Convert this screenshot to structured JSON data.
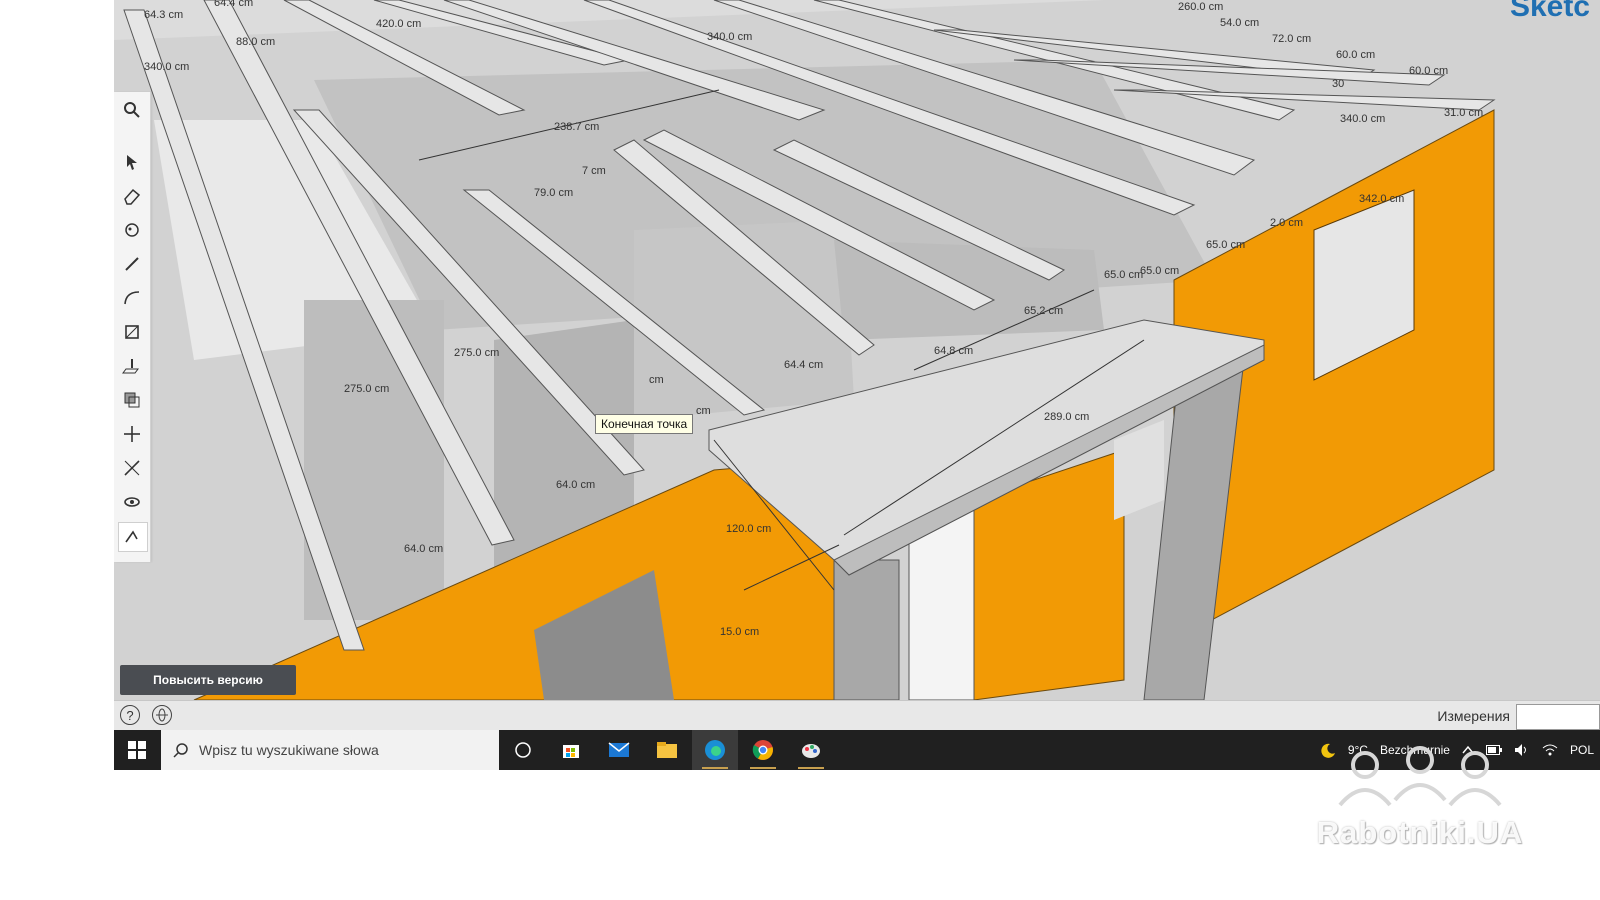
{
  "app": {
    "brand_fragment": "Sketc"
  },
  "colors": {
    "wall": "#f29a05",
    "beam": "#e6e6e6",
    "floor": "#c8c8c8",
    "taskbar": "#202020"
  },
  "toolbar": {
    "tools": [
      "search-icon",
      "select-icon",
      "eraser-icon",
      "paint-bucket-icon",
      "pencil-icon",
      "arc-icon",
      "rectangle-icon",
      "push-pull-icon",
      "offset-icon",
      "move-icon",
      "tape-measure-icon",
      "orbit-icon",
      "dimension-icon"
    ]
  },
  "dimensions": [
    {
      "id": "d1",
      "text": "64.3 cm"
    },
    {
      "id": "d2",
      "text": "64.4 cm"
    },
    {
      "id": "d3",
      "text": "88.0 cm"
    },
    {
      "id": "d4",
      "text": "420.0 cm"
    },
    {
      "id": "d5",
      "text": "340.0 cm"
    },
    {
      "id": "d6",
      "text": "340.0 cm"
    },
    {
      "id": "d7",
      "text": "260.0 cm"
    },
    {
      "id": "d8",
      "text": "54.0 cm"
    },
    {
      "id": "d9",
      "text": "72.0 cm"
    },
    {
      "id": "d10",
      "text": "60.0 cm"
    },
    {
      "id": "d11",
      "text": "60.0 cm"
    },
    {
      "id": "d12",
      "text": "30"
    },
    {
      "id": "d13",
      "text": "340.0 cm"
    },
    {
      "id": "d14",
      "text": "31.0 cm"
    },
    {
      "id": "d15",
      "text": "238.7 cm"
    },
    {
      "id": "d16",
      "text": "7 cm"
    },
    {
      "id": "d17",
      "text": "79.0 cm"
    },
    {
      "id": "d18",
      "text": "342.0 cm"
    },
    {
      "id": "d19",
      "text": "2.0 cm"
    },
    {
      "id": "d20",
      "text": "65.0 cm"
    },
    {
      "id": "d21",
      "text": "65.0 cm"
    },
    {
      "id": "d22",
      "text": "65.0 cm"
    },
    {
      "id": "d23",
      "text": "65.2 cm"
    },
    {
      "id": "d24",
      "text": "64.8 cm"
    },
    {
      "id": "d25",
      "text": "64.4 cm"
    },
    {
      "id": "d26",
      "text": "275.0 cm"
    },
    {
      "id": "d27",
      "text": "275.0 cm"
    },
    {
      "id": "d28",
      "text": "cm"
    },
    {
      "id": "d29",
      "text": "cm"
    },
    {
      "id": "d30",
      "text": "289.0 cm"
    },
    {
      "id": "d31",
      "text": "64.0 cm"
    },
    {
      "id": "d32",
      "text": "64.0 cm"
    },
    {
      "id": "d33",
      "text": "120.0 cm"
    },
    {
      "id": "d34",
      "text": "15.0 cm"
    }
  ],
  "tooltip": {
    "text": "Конечная точка"
  },
  "upgrade_button": {
    "label": "Повысить версию"
  },
  "statusbar": {
    "help_label": "?",
    "measurements_label": "Измерения",
    "measurements_value": ""
  },
  "taskbar": {
    "search_placeholder": "Wpisz tu wyszukiwane słowa",
    "weather_temp": "9°C",
    "weather_desc": "Bezchmurnie",
    "language": "POL"
  },
  "watermark": {
    "text": "Rabotniki.UA"
  }
}
